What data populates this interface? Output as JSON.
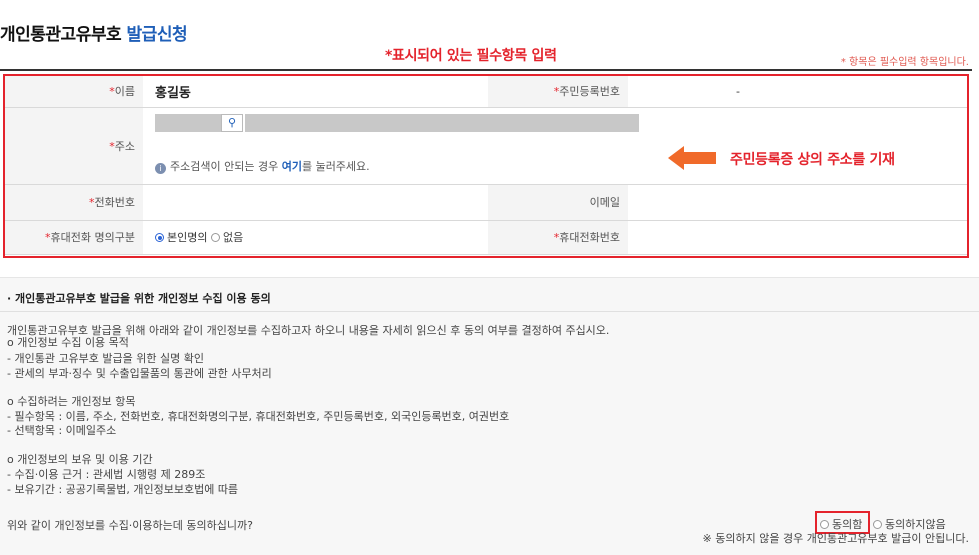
{
  "header": {
    "title_main": "개인통관고유부호 ",
    "title_accent": "발급신청",
    "required_note": "* 항목은 필수입력 항목입니다."
  },
  "annotations": {
    "top": "*표시되어 있는 필수항목 입력",
    "address": "주민등록증 상의 주소를 기재",
    "accent_color": "#e4232c"
  },
  "form": {
    "name_label": "이름",
    "name_value": "홍길동",
    "rrn_label": "주민등록번호",
    "rrn_value": "-",
    "address_label": "주소",
    "address_search_icon": "search-icon",
    "address_note_prefix": "주소검색이 안되는 경우 ",
    "address_note_link": "여기",
    "address_note_suffix": "를 눌러주세요.",
    "phone_label": "전화번호",
    "email_label": "이메일",
    "mobile_owner_label": "휴대전화 명의구분",
    "mobile_owner_options": [
      "본인명의",
      "없음"
    ],
    "mobile_owner_selected": "본인명의",
    "mobile_label": "휴대전화번호"
  },
  "consent": {
    "heading": "· 개인통관고유부호 발급을 위한 개인정보 수집 이용 동의",
    "intro": "개인통관고유부호 발급을 위해 아래와 같이 개인정보를 수집하고자 하오니 내용을 자세히 읽으신 후 동의 여부를 결정하여 주십시오.",
    "purpose_title": "o  개인정보 수집 이용 목적",
    "purpose_1": "  - 개인통관 고유부호 발급을 위한 실명 확인",
    "purpose_2": "  - 관세의 부과·징수 및 수출입물품의 통관에 관한 사무처리",
    "items_title": "o  수집하려는 개인정보 항목",
    "items_1": "  - 필수항목 : 이름, 주소, 전화번호, 휴대전화명의구분, 휴대전화번호, 주민등록번호, 외국인등록번호, 여권번호",
    "items_2": "  - 선택항목 : 이메일주소",
    "retention_title": "o  개인정보의 보유 및 이용 기간",
    "retention_1": "  - 수집·이용 근거 : 관세법 시행령 제 289조",
    "retention_2": "  - 보유기간 : 공공기록물법, 개인정보보호법에 따름",
    "question": "위와 같이 개인정보를 수집·이용하는데 동의하십니까?",
    "agree_label": "동의함",
    "disagree_label": "동의하지않음",
    "warning": "※ 동의하지 않을 경우 개인통관고유부호 발급이 안됩니다."
  }
}
